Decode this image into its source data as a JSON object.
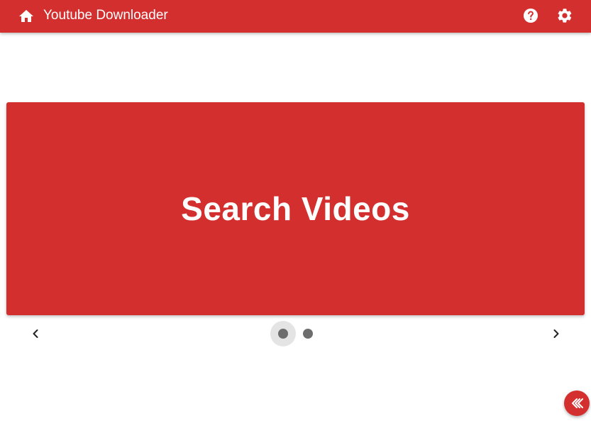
{
  "appbar": {
    "title": "Youtube Downloader",
    "home_icon": "home-icon",
    "help_icon": "help-circle-icon",
    "settings_icon": "gear-icon",
    "background_color": "#d32f2f"
  },
  "carousel": {
    "slides": [
      {
        "title": "Search Videos"
      }
    ],
    "active_index": 0,
    "total_slides": 2,
    "prev_icon": "chevron-left-icon",
    "next_icon": "chevron-right-icon"
  },
  "fab": {
    "icon": "double-chevron-left-icon",
    "color": "#d32f2f"
  }
}
